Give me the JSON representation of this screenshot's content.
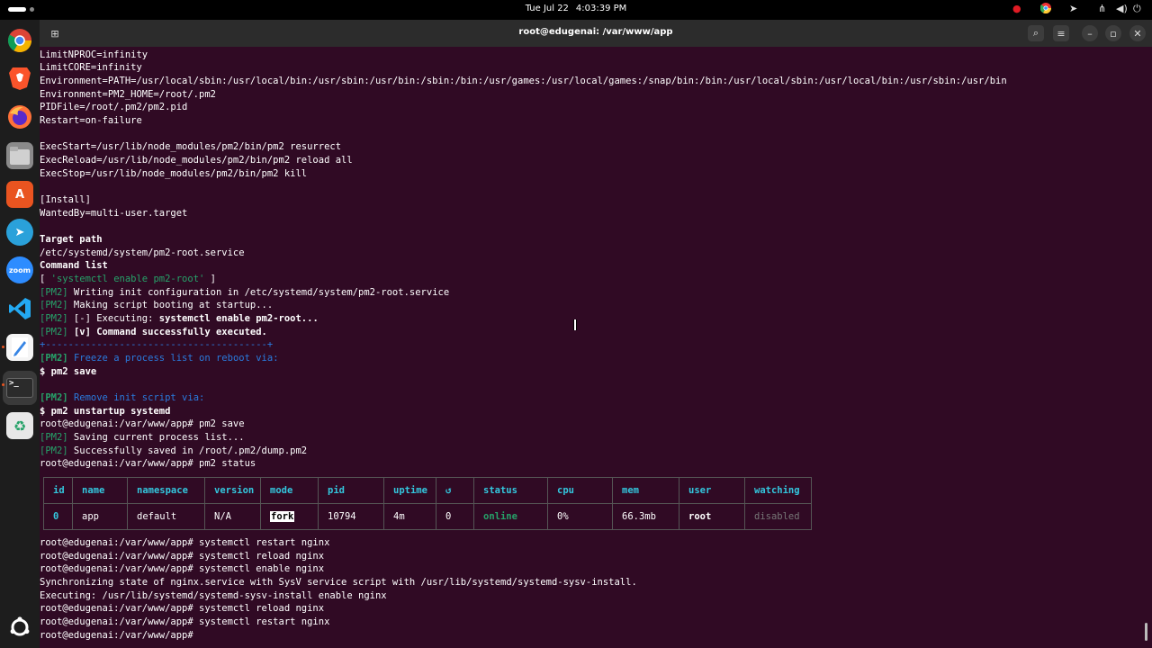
{
  "topbar": {
    "date": "Tue Jul 22",
    "time": "4:03:39 PM"
  },
  "window": {
    "title": "root@edugenai: /var/www/app"
  },
  "dock": {
    "zoom_label": "zoom"
  },
  "terminal": {
    "lines": [
      "LimitNPROC=infinity",
      "LimitCORE=infinity",
      "Environment=PATH=/usr/local/sbin:/usr/local/bin:/usr/sbin:/usr/bin:/sbin:/bin:/usr/games:/usr/local/games:/snap/bin:/bin:/usr/local/sbin:/usr/local/bin:/usr/sbin:/usr/bin",
      "Environment=PM2_HOME=/root/.pm2",
      "PIDFile=/root/.pm2/pm2.pid",
      "Restart=on-failure",
      "ExecStart=/usr/lib/node_modules/pm2/bin/pm2 resurrect",
      "ExecReload=/usr/lib/node_modules/pm2/bin/pm2 reload all",
      "ExecStop=/usr/lib/node_modules/pm2/bin/pm2 kill",
      "[Install]",
      "WantedBy=multi-user.target",
      "Target path",
      "/etc/systemd/system/pm2-root.service",
      "Command list",
      "[ ",
      "'systemctl enable pm2-root'",
      " ]",
      "[PM2]",
      " Writing init configuration in /etc/systemd/system/pm2-root.service",
      " Making script booting at startup...",
      " [-] Executing: ",
      "systemctl enable pm2-root...",
      "[v] Command successfully executed.",
      "+---------------------------------------+",
      "Freeze a process list on reboot via:",
      "$ pm2 save",
      "Remove init script via:",
      "$ pm2 unstartup systemd",
      "root@edugenai:/var/www/app# pm2 save",
      " Saving current process list...",
      " Successfully saved in /root/.pm2/dump.pm2",
      "root@edugenai:/var/www/app# pm2 status",
      "root@edugenai:/var/www/app# systemctl restart nginx",
      "root@edugenai:/var/www/app# systemctl reload nginx",
      "root@edugenai:/var/www/app# systemctl enable nginx",
      "Synchronizing state of nginx.service with SysV service script with /usr/lib/systemd/systemd-sysv-install.",
      "Executing: /usr/lib/systemd/systemd-sysv-install enable nginx",
      "root@edugenai:/var/www/app# systemctl reload nginx",
      "root@edugenai:/var/www/app# systemctl restart nginx",
      "root@edugenai:/var/www/app# "
    ]
  },
  "pm2_table": {
    "headers": [
      "id",
      "name",
      "namespace",
      "version",
      "mode",
      "pid",
      "uptime",
      "↺",
      "status",
      "cpu",
      "mem",
      "user",
      "watching"
    ],
    "row": [
      "0",
      "app",
      "default",
      "N/A",
      "fork",
      "10794",
      "4m",
      "0",
      "online",
      "0%",
      "66.3mb",
      "root",
      "disabled"
    ]
  }
}
